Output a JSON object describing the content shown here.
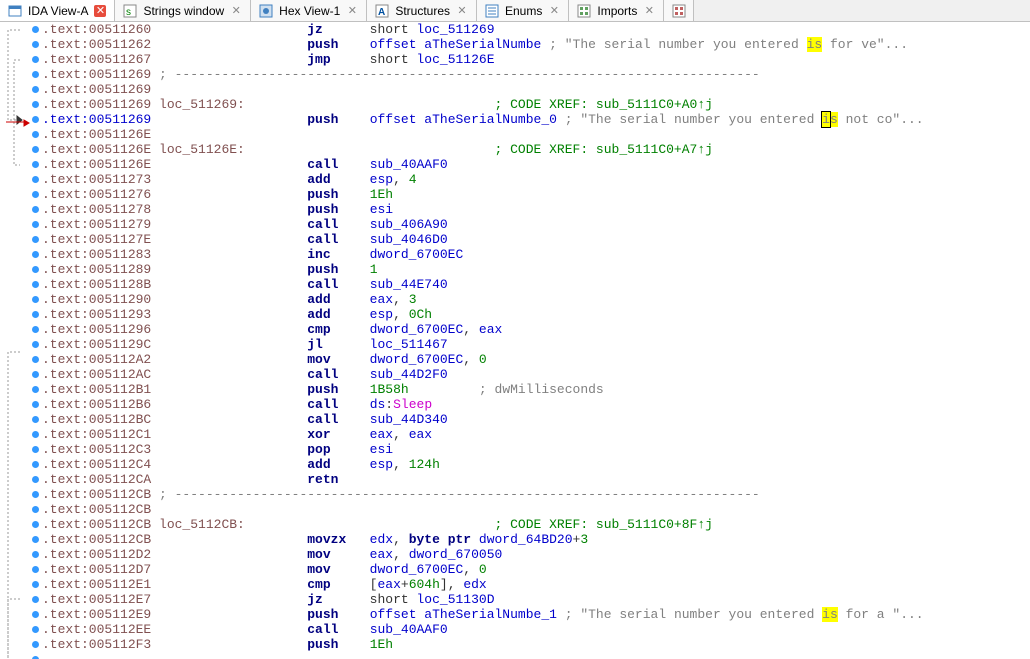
{
  "tabs": [
    {
      "label": "IDA View-A",
      "active": true,
      "icon": "ida-view"
    },
    {
      "label": "Strings window",
      "active": false,
      "icon": "strings"
    },
    {
      "label": "Hex View-1",
      "active": false,
      "icon": "hex"
    },
    {
      "label": "Structures",
      "active": false,
      "icon": "struct"
    },
    {
      "label": "Enums",
      "active": false,
      "icon": "enum"
    },
    {
      "label": "Imports",
      "active": false,
      "icon": "imports"
    }
  ],
  "disassembly": [
    {
      "addr": ".text:00511260",
      "op": "jz",
      "args": [
        {
          "t": "short ",
          "c": "txt"
        },
        {
          "t": "loc_511269",
          "c": "blue"
        }
      ]
    },
    {
      "addr": ".text:00511262",
      "op": "push",
      "args": [
        {
          "t": "offset ",
          "c": "blue"
        },
        {
          "t": "aTheSerialNumbe",
          "c": "blue"
        },
        {
          "t": " ; ",
          "c": "gray"
        },
        {
          "t": "\"The serial number you entered ",
          "c": "gray"
        },
        {
          "t": "is",
          "c": "gray",
          "hl": true
        },
        {
          "t": " for ve\"...",
          "c": "gray"
        }
      ]
    },
    {
      "addr": ".text:00511267",
      "op": "jmp",
      "args": [
        {
          "t": "short ",
          "c": "txt"
        },
        {
          "t": "loc_51126E",
          "c": "blue"
        }
      ]
    },
    {
      "addr": ".text:00511269",
      "sep": true
    },
    {
      "addr": ".text:00511269"
    },
    {
      "addr": ".text:00511269",
      "label": "loc_511269:",
      "xref": "; CODE XREF: sub_5111C0+A0↑j"
    },
    {
      "addr": ".text:00511269",
      "addr_blue": true,
      "op": "push",
      "args": [
        {
          "t": "offset ",
          "c": "blue"
        },
        {
          "t": "aTheSerialNumbe_0",
          "c": "blue"
        },
        {
          "t": " ; ",
          "c": "gray"
        },
        {
          "t": "\"The serial number you entered ",
          "c": "gray"
        },
        {
          "t": "i",
          "c": "gray",
          "cursor": true
        },
        {
          "t": "s",
          "c": "gray",
          "hl": true
        },
        {
          "t": " not co\"...",
          "c": "gray"
        }
      ]
    },
    {
      "addr": ".text:0051126E"
    },
    {
      "addr": ".text:0051126E",
      "label": "loc_51126E:",
      "xref": "; CODE XREF: sub_5111C0+A7↑j"
    },
    {
      "addr": ".text:0051126E",
      "op": "call",
      "args": [
        {
          "t": "sub_40AAF0",
          "c": "blue"
        }
      ]
    },
    {
      "addr": ".text:00511273",
      "op": "add",
      "args": [
        {
          "t": "esp",
          "c": "blue"
        },
        {
          "t": ", ",
          "c": "txt"
        },
        {
          "t": "4",
          "c": "green"
        }
      ]
    },
    {
      "addr": ".text:00511276",
      "op": "push",
      "args": [
        {
          "t": "1Eh",
          "c": "green"
        }
      ]
    },
    {
      "addr": ".text:00511278",
      "op": "push",
      "args": [
        {
          "t": "esi",
          "c": "blue"
        }
      ]
    },
    {
      "addr": ".text:00511279",
      "op": "call",
      "args": [
        {
          "t": "sub_406A90",
          "c": "blue"
        }
      ]
    },
    {
      "addr": ".text:0051127E",
      "op": "call",
      "args": [
        {
          "t": "sub_4046D0",
          "c": "blue"
        }
      ]
    },
    {
      "addr": ".text:00511283",
      "op": "inc",
      "args": [
        {
          "t": "dword_6700EC",
          "c": "blue"
        }
      ]
    },
    {
      "addr": ".text:00511289",
      "op": "push",
      "args": [
        {
          "t": "1",
          "c": "green"
        }
      ]
    },
    {
      "addr": ".text:0051128B",
      "op": "call",
      "args": [
        {
          "t": "sub_44E740",
          "c": "blue"
        }
      ]
    },
    {
      "addr": ".text:00511290",
      "op": "add",
      "args": [
        {
          "t": "eax",
          "c": "blue"
        },
        {
          "t": ", ",
          "c": "txt"
        },
        {
          "t": "3",
          "c": "green"
        }
      ]
    },
    {
      "addr": ".text:00511293",
      "op": "add",
      "args": [
        {
          "t": "esp",
          "c": "blue"
        },
        {
          "t": ", ",
          "c": "txt"
        },
        {
          "t": "0Ch",
          "c": "green"
        }
      ]
    },
    {
      "addr": ".text:00511296",
      "op": "cmp",
      "args": [
        {
          "t": "dword_6700EC",
          "c": "blue"
        },
        {
          "t": ", ",
          "c": "txt"
        },
        {
          "t": "eax",
          "c": "blue"
        }
      ]
    },
    {
      "addr": ".text:0051129C",
      "op": "jl",
      "args": [
        {
          "t": "loc_511467",
          "c": "blue"
        }
      ]
    },
    {
      "addr": ".text:005112A2",
      "op": "mov",
      "args": [
        {
          "t": "dword_6700EC",
          "c": "blue"
        },
        {
          "t": ", ",
          "c": "txt"
        },
        {
          "t": "0",
          "c": "green"
        }
      ]
    },
    {
      "addr": ".text:005112AC",
      "op": "call",
      "args": [
        {
          "t": "sub_44D2F0",
          "c": "blue"
        }
      ]
    },
    {
      "addr": ".text:005112B1",
      "op": "push",
      "args": [
        {
          "t": "1B58h",
          "c": "green"
        },
        {
          "t": "         ; dwMilliseconds",
          "c": "gray"
        }
      ]
    },
    {
      "addr": ".text:005112B6",
      "op": "call",
      "args": [
        {
          "t": "ds",
          "c": "blue"
        },
        {
          "t": ":",
          "c": "txt"
        },
        {
          "t": "Sleep",
          "c": "purple"
        }
      ]
    },
    {
      "addr": ".text:005112BC",
      "op": "call",
      "args": [
        {
          "t": "sub_44D340",
          "c": "blue"
        }
      ]
    },
    {
      "addr": ".text:005112C1",
      "op": "xor",
      "args": [
        {
          "t": "eax",
          "c": "blue"
        },
        {
          "t": ", ",
          "c": "txt"
        },
        {
          "t": "eax",
          "c": "blue"
        }
      ]
    },
    {
      "addr": ".text:005112C3",
      "op": "pop",
      "args": [
        {
          "t": "esi",
          "c": "blue"
        }
      ]
    },
    {
      "addr": ".text:005112C4",
      "op": "add",
      "args": [
        {
          "t": "esp",
          "c": "blue"
        },
        {
          "t": ", ",
          "c": "txt"
        },
        {
          "t": "124h",
          "c": "green"
        }
      ]
    },
    {
      "addr": ".text:005112CA",
      "op": "retn"
    },
    {
      "addr": ".text:005112CB",
      "sep": true
    },
    {
      "addr": ".text:005112CB"
    },
    {
      "addr": ".text:005112CB",
      "label": "loc_5112CB:",
      "xref": "; CODE XREF: sub_5111C0+8F↑j"
    },
    {
      "addr": ".text:005112CB",
      "op": "movzx",
      "args": [
        {
          "t": "edx",
          "c": "blue"
        },
        {
          "t": ", ",
          "c": "txt"
        },
        {
          "t": "byte ptr ",
          "c": "navy"
        },
        {
          "t": "dword_64BD20",
          "c": "blue"
        },
        {
          "t": "+",
          "c": "txt"
        },
        {
          "t": "3",
          "c": "green"
        }
      ]
    },
    {
      "addr": ".text:005112D2",
      "op": "mov",
      "args": [
        {
          "t": "eax",
          "c": "blue"
        },
        {
          "t": ", ",
          "c": "txt"
        },
        {
          "t": "dword_670050",
          "c": "blue"
        }
      ]
    },
    {
      "addr": ".text:005112D7",
      "op": "mov",
      "args": [
        {
          "t": "dword_6700EC",
          "c": "blue"
        },
        {
          "t": ", ",
          "c": "txt"
        },
        {
          "t": "0",
          "c": "green"
        }
      ]
    },
    {
      "addr": ".text:005112E1",
      "op": "cmp",
      "args": [
        {
          "t": "[",
          "c": "txt"
        },
        {
          "t": "eax",
          "c": "blue"
        },
        {
          "t": "+",
          "c": "txt"
        },
        {
          "t": "604h",
          "c": "green"
        },
        {
          "t": "], ",
          "c": "txt"
        },
        {
          "t": "edx",
          "c": "blue"
        }
      ]
    },
    {
      "addr": ".text:005112E7",
      "op": "jz",
      "args": [
        {
          "t": "short ",
          "c": "txt"
        },
        {
          "t": "loc_51130D",
          "c": "blue"
        }
      ]
    },
    {
      "addr": ".text:005112E9",
      "op": "push",
      "args": [
        {
          "t": "offset ",
          "c": "blue"
        },
        {
          "t": "aTheSerialNumbe_1",
          "c": "blue"
        },
        {
          "t": " ; ",
          "c": "gray"
        },
        {
          "t": "\"The serial number you entered ",
          "c": "gray"
        },
        {
          "t": "is",
          "c": "gray",
          "hl": true
        },
        {
          "t": " for a \"...",
          "c": "gray"
        }
      ]
    },
    {
      "addr": ".text:005112EE",
      "op": "call",
      "args": [
        {
          "t": "sub_40AAF0",
          "c": "blue"
        }
      ]
    },
    {
      "addr": ".text:005112F3",
      "op": "push",
      "args": [
        {
          "t": "1Eh",
          "c": "green"
        }
      ]
    }
  ],
  "line_height": 15,
  "op_col": 210,
  "arg_col": 272,
  "xref_col": 395
}
